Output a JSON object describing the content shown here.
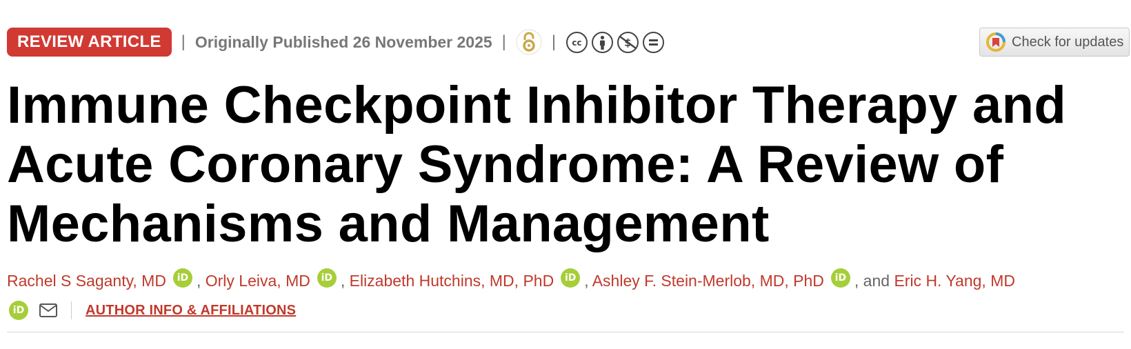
{
  "header": {
    "badge": "REVIEW ARTICLE",
    "separator": "|",
    "published": "Originally Published 26 November 2025",
    "open_access_icon": "open-access-icon",
    "license_icons": [
      "cc-icon",
      "by-attribution-icon",
      "noncommercial-icon",
      "noderivatives-icon"
    ],
    "check_updates_label": "Check for updates"
  },
  "title": "Immune Checkpoint Inhibitor Therapy and Acute Coronary Syndrome: A Review of Mechanisms and Management",
  "authors": [
    {
      "name": "Rachel S Saganty, MD",
      "orcid": true
    },
    {
      "name": "Orly Leiva, MD",
      "orcid": true
    },
    {
      "name": "Elizabeth Hutchins, MD, PhD",
      "orcid": true
    },
    {
      "name": "Ashley F. Stein-Merlob, MD, PhD",
      "orcid": true
    },
    {
      "name": "Eric H. Yang, MD",
      "orcid": true
    }
  ],
  "author_sep": ", ",
  "author_and": ", and ",
  "orcid_label": "iD",
  "affiliations_link": "AUTHOR INFO & AFFILIATIONS",
  "colors": {
    "accent": "#c0392b",
    "badge_bg": "#d03a33",
    "orcid": "#a6ce39",
    "open_access": "#c9a84a"
  }
}
